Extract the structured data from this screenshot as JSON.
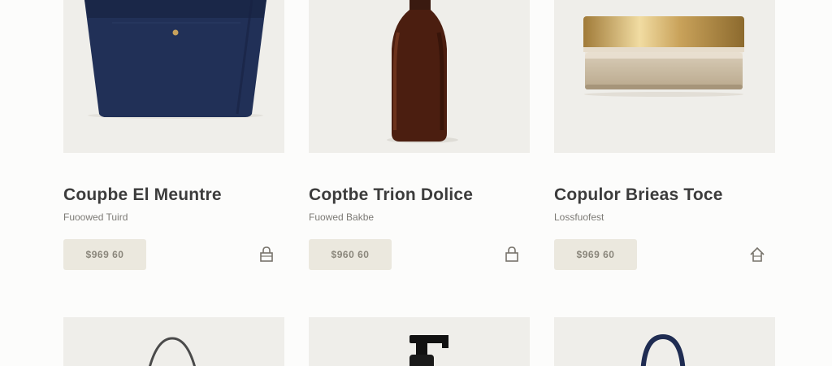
{
  "products": [
    {
      "name": "Coupbe El Meuntre",
      "subtitle": "Fuoowed Tuird",
      "price": "$969 60",
      "image_icon": "navy-tote-bag-icon",
      "cart_icon": "shopping-bag-icon"
    },
    {
      "name": "Coptbe Trion Dolice",
      "subtitle": "Fuowed Bakbe",
      "price": "$960 60",
      "image_icon": "amber-bottle-icon",
      "cart_icon": "shopping-bag-icon"
    },
    {
      "name": "Copulor Brieas Toce",
      "subtitle": "Lossfuofest",
      "price": "$969 60",
      "image_icon": "cosmetic-jar-icon",
      "cart_icon": "home-icon"
    }
  ],
  "row2_products": [
    {
      "image_icon": "handbag-icon"
    },
    {
      "image_icon": "pump-bottle-icon"
    },
    {
      "image_icon": "navy-bag-icon"
    }
  ],
  "colors": {
    "card_bg": "#efeeea",
    "price_bg": "#ebe8de",
    "title": "#3c3c3c",
    "navy": "#1f2c52",
    "gold": "#c9a860"
  }
}
